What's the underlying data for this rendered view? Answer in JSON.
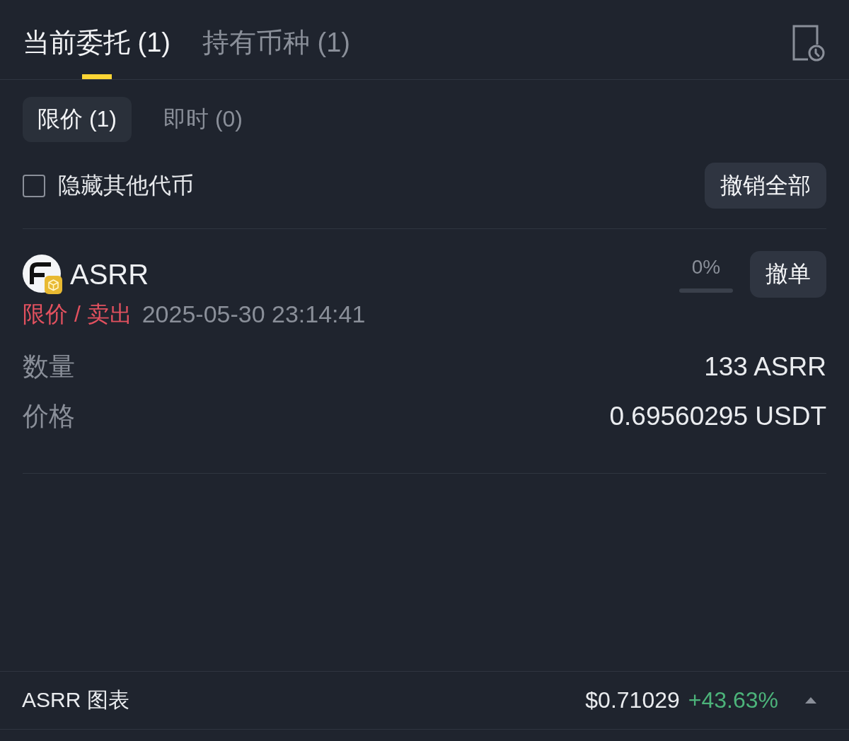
{
  "tabs": [
    {
      "label": "当前委托 (1)",
      "selected": true
    },
    {
      "label": "持有币种 (1)",
      "selected": false
    }
  ],
  "order_type_tabs": [
    {
      "label": "限价 (1)",
      "selected": true
    },
    {
      "label": "即时 (0)",
      "selected": false
    }
  ],
  "hide_other_tokens": {
    "label": "隐藏其他代币",
    "checked": false
  },
  "cancel_all_button": "撤销全部",
  "orders": [
    {
      "symbol": "ASRR",
      "filled_reading": "0%",
      "level": 0,
      "cancel_button": "撤单",
      "order_type": "限价 / 卖出",
      "time": "2025-05-30 23:14:41",
      "fields": [
        {
          "label": "数量",
          "value": "133 ASRR"
        },
        {
          "label": "价格",
          "value": "0.69560295 USDT"
        }
      ]
    }
  ],
  "chart_bar": {
    "label": "ASRR 图表",
    "price": "$0.71029",
    "change": "+43.63%"
  }
}
